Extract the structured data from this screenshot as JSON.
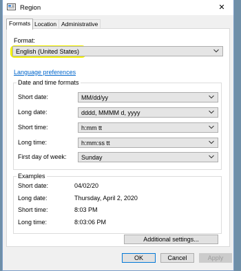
{
  "window": {
    "title": "Region",
    "close_label": "✕"
  },
  "tabs": [
    {
      "label": "Formats"
    },
    {
      "label": "Location"
    },
    {
      "label": "Administrative"
    }
  ],
  "format": {
    "label": "Format:",
    "value": "English (United States)",
    "highlight_color": "#f5f200"
  },
  "language_link": "Language preferences",
  "date_time": {
    "title": "Date and time formats",
    "rows": [
      {
        "label": "Short date:",
        "value": "MM/dd/yy"
      },
      {
        "label": "Long date:",
        "value": "dddd, MMMM d, yyyy"
      },
      {
        "label": "Short time:",
        "value": "h:mm tt"
      },
      {
        "label": "Long time:",
        "value": "h:mm:ss tt"
      },
      {
        "label": "First day of week:",
        "value": "Sunday"
      }
    ]
  },
  "examples": {
    "title": "Examples",
    "rows": [
      {
        "label": "Short date:",
        "value": "04/02/20"
      },
      {
        "label": "Long date:",
        "value": "Thursday, April 2, 2020"
      },
      {
        "label": "Short time:",
        "value": "8:03 PM"
      },
      {
        "label": "Long time:",
        "value": "8:03:06 PM"
      }
    ]
  },
  "buttons": {
    "additional": "Additional settings...",
    "ok": "OK",
    "cancel": "Cancel",
    "apply": "Apply"
  },
  "colors": {
    "link": "#0066cc",
    "accent_border": "#0078d7"
  }
}
